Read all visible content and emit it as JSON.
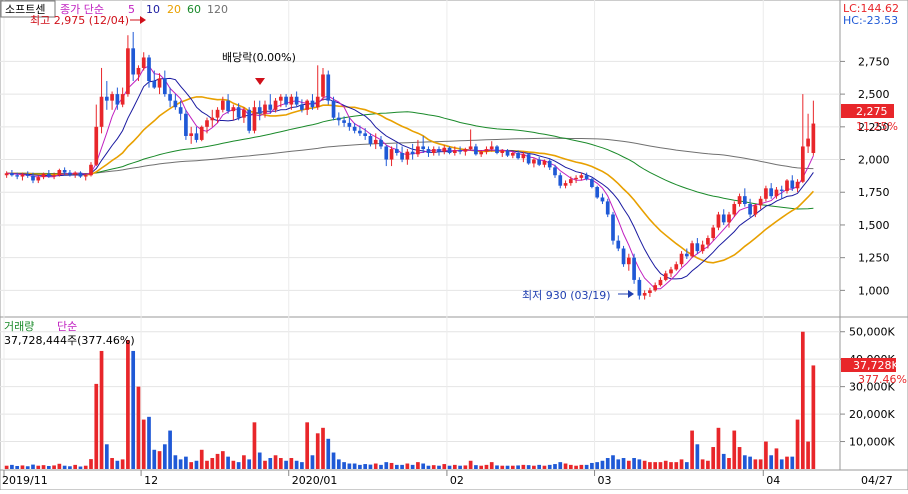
{
  "header": {
    "stock_name": "소프트센",
    "price_label": "종가 단순",
    "ma_labels": [
      {
        "text": "5",
        "color": "#c020c0"
      },
      {
        "text": "10",
        "color": "#1a1aa0"
      },
      {
        "text": "20",
        "color": "#e8a000"
      },
      {
        "text": "60",
        "color": "#1a8a2a"
      },
      {
        "text": "120",
        "color": "#707070"
      }
    ],
    "lc": "LC:144.62",
    "hc": "HC:-23.53"
  },
  "annotations": {
    "high": "최고 2,975 (12/04)",
    "dividend": "배당락(0.00%)",
    "low": "최저 930 (03/19)"
  },
  "price_badge": {
    "value": "2,275",
    "pct": "11.25%"
  },
  "volume_header": {
    "label": "거래량",
    "label2": "단순",
    "value": "37,728,444주(377.46%)"
  },
  "volume_badge": {
    "value": "37,728K",
    "pct": "377.46%"
  },
  "price_axis": [
    "2,750",
    "2,500",
    "2,250",
    "2,000",
    "1,750",
    "1,500",
    "1,250",
    "1,000"
  ],
  "volume_axis": [
    "50,000K",
    "40,000K",
    "30,000K",
    "20,000K",
    "10,000K"
  ],
  "date_axis": [
    "2019/11",
    "12",
    "2020/01",
    "02",
    "03",
    "04",
    "04/27"
  ],
  "colors": {
    "up": "#e8262a",
    "down": "#1f59d6",
    "ma5": "#c020c0",
    "ma10": "#1a1aa0",
    "ma20": "#e8a000",
    "ma60": "#1a8a2a",
    "ma120": "#707070"
  },
  "chart_data": {
    "type": "candlestick",
    "price_range": [
      850,
      2990
    ],
    "volume_range_k": [
      0,
      55000
    ],
    "candles": [
      [
        1880,
        1910,
        1860,
        1895,
        1200
      ],
      [
        1895,
        1920,
        1870,
        1880,
        1500
      ],
      [
        1880,
        1900,
        1850,
        1870,
        1100
      ],
      [
        1870,
        1900,
        1840,
        1885,
        1300
      ],
      [
        1885,
        1910,
        1860,
        1875,
        1000
      ],
      [
        1875,
        1900,
        1820,
        1840,
        1600
      ],
      [
        1840,
        1880,
        1820,
        1865,
        1200
      ],
      [
        1865,
        1900,
        1850,
        1890,
        1400
      ],
      [
        1890,
        1920,
        1860,
        1870,
        1100
      ],
      [
        1870,
        1900,
        1850,
        1880,
        1300
      ],
      [
        1880,
        1930,
        1870,
        1920,
        1900
      ],
      [
        1920,
        1940,
        1880,
        1900,
        1200
      ],
      [
        1900,
        1920,
        1870,
        1885,
        1000
      ],
      [
        1885,
        1910,
        1860,
        1900,
        1500
      ],
      [
        1900,
        1910,
        1860,
        1870,
        900
      ],
      [
        1870,
        1890,
        1840,
        1880,
        1200
      ],
      [
        1880,
        1980,
        1870,
        1960,
        3600
      ],
      [
        1960,
        2420,
        1950,
        2250,
        31000
      ],
      [
        2250,
        2700,
        2200,
        2480,
        43000
      ],
      [
        2480,
        2600,
        2380,
        2450,
        9000
      ],
      [
        2450,
        2520,
        2380,
        2500,
        4000
      ],
      [
        2500,
        2550,
        2380,
        2420,
        3000
      ],
      [
        2420,
        2550,
        2400,
        2500,
        3500
      ],
      [
        2500,
        2950,
        2480,
        2850,
        47000
      ],
      [
        2850,
        2975,
        2600,
        2650,
        43000
      ],
      [
        2650,
        2720,
        2600,
        2700,
        30000
      ],
      [
        2700,
        2820,
        2680,
        2780,
        18000
      ],
      [
        2780,
        2800,
        2550,
        2600,
        19000
      ],
      [
        2600,
        2680,
        2540,
        2550,
        7000
      ],
      [
        2550,
        2660,
        2500,
        2620,
        6500
      ],
      [
        2620,
        2680,
        2480,
        2500,
        9000
      ],
      [
        2500,
        2550,
        2400,
        2450,
        14000
      ],
      [
        2450,
        2500,
        2380,
        2400,
        5000
      ],
      [
        2400,
        2450,
        2300,
        2350,
        3500
      ],
      [
        2350,
        2380,
        2150,
        2180,
        4500
      ],
      [
        2180,
        2250,
        2120,
        2200,
        2500
      ],
      [
        2200,
        2250,
        2130,
        2150,
        3000
      ],
      [
        2150,
        2260,
        2140,
        2250,
        7000
      ],
      [
        2250,
        2320,
        2200,
        2300,
        3000
      ],
      [
        2300,
        2380,
        2250,
        2320,
        4000
      ],
      [
        2320,
        2400,
        2280,
        2380,
        5500
      ],
      [
        2380,
        2480,
        2360,
        2450,
        6500
      ],
      [
        2450,
        2500,
        2350,
        2370,
        4500
      ],
      [
        2370,
        2420,
        2300,
        2400,
        3000
      ],
      [
        2400,
        2430,
        2300,
        2320,
        2500
      ],
      [
        2320,
        2400,
        2280,
        2380,
        5000
      ],
      [
        2380,
        2400,
        2200,
        2220,
        3500
      ],
      [
        2220,
        2450,
        2200,
        2400,
        17000
      ],
      [
        2400,
        2450,
        2300,
        2350,
        6000
      ],
      [
        2350,
        2450,
        2320,
        2420,
        3000
      ],
      [
        2420,
        2500,
        2350,
        2380,
        4000
      ],
      [
        2380,
        2470,
        2360,
        2450,
        5000
      ],
      [
        2450,
        2500,
        2400,
        2480,
        4000
      ],
      [
        2480,
        2500,
        2400,
        2420,
        3000
      ],
      [
        2420,
        2500,
        2380,
        2480,
        4000
      ],
      [
        2480,
        2520,
        2400,
        2420,
        3000
      ],
      [
        2420,
        2460,
        2360,
        2380,
        2500
      ],
      [
        2380,
        2460,
        2340,
        2450,
        17000
      ],
      [
        2450,
        2500,
        2380,
        2400,
        5000
      ],
      [
        2400,
        2720,
        2380,
        2480,
        13000
      ],
      [
        2480,
        2700,
        2450,
        2650,
        15000
      ],
      [
        2650,
        2680,
        2420,
        2450,
        11000
      ],
      [
        2450,
        2480,
        2300,
        2320,
        6000
      ],
      [
        2320,
        2360,
        2260,
        2300,
        3500
      ],
      [
        2300,
        2330,
        2250,
        2280,
        2500
      ],
      [
        2280,
        2320,
        2220,
        2250,
        2000
      ],
      [
        2250,
        2280,
        2200,
        2220,
        2000
      ],
      [
        2220,
        2260,
        2180,
        2200,
        1500
      ],
      [
        2200,
        2240,
        2150,
        2180,
        1800
      ],
      [
        2180,
        2200,
        2100,
        2120,
        1600
      ],
      [
        2120,
        2200,
        2080,
        2150,
        2000
      ],
      [
        2150,
        2180,
        2080,
        2100,
        1500
      ],
      [
        2100,
        2110,
        1950,
        2000,
        2500
      ],
      [
        2000,
        2100,
        1950,
        2080,
        2200
      ],
      [
        2080,
        2120,
        2030,
        2050,
        1500
      ],
      [
        2050,
        2100,
        1980,
        2000,
        1500
      ],
      [
        2000,
        2080,
        1960,
        2060,
        2000
      ],
      [
        2060,
        2120,
        2000,
        2040,
        1500
      ],
      [
        2040,
        2150,
        2020,
        2100,
        2500
      ],
      [
        2100,
        2180,
        2050,
        2080,
        2000
      ],
      [
        2080,
        2100,
        2020,
        2050,
        1200
      ],
      [
        2050,
        2100,
        2030,
        2080,
        1400
      ],
      [
        2080,
        2100,
        2030,
        2060,
        1200
      ],
      [
        2060,
        2110,
        2040,
        2090,
        1800
      ],
      [
        2090,
        2100,
        2040,
        2050,
        1200
      ],
      [
        2050,
        2100,
        2030,
        2070,
        1500
      ],
      [
        2070,
        2100,
        2040,
        2060,
        1200
      ],
      [
        2060,
        2090,
        2030,
        2080,
        1300
      ],
      [
        2080,
        2230,
        2070,
        2100,
        3000
      ],
      [
        2100,
        2120,
        2030,
        2040,
        1400
      ],
      [
        2040,
        2070,
        2020,
        2060,
        1200
      ],
      [
        2060,
        2100,
        2040,
        2080,
        1500
      ],
      [
        2080,
        2140,
        2060,
        2100,
        2500
      ],
      [
        2100,
        2110,
        2040,
        2050,
        1300
      ],
      [
        2050,
        2080,
        2020,
        2070,
        1200
      ],
      [
        2070,
        2080,
        2020,
        2030,
        1200
      ],
      [
        2030,
        2060,
        2010,
        2050,
        1200
      ],
      [
        2050,
        2070,
        2000,
        2010,
        1300
      ],
      [
        2010,
        2060,
        1980,
        2040,
        1500
      ],
      [
        2040,
        2050,
        1960,
        1970,
        1400
      ],
      [
        1970,
        2010,
        1940,
        2000,
        1200
      ],
      [
        2000,
        2020,
        1950,
        1960,
        1500
      ],
      [
        1960,
        2000,
        1940,
        1990,
        1200
      ],
      [
        1990,
        2010,
        1920,
        1940,
        1500
      ],
      [
        1940,
        1960,
        1860,
        1880,
        1800
      ],
      [
        1880,
        1900,
        1780,
        1800,
        2500
      ],
      [
        1800,
        1840,
        1780,
        1820,
        2000
      ],
      [
        1820,
        1870,
        1800,
        1850,
        1500
      ],
      [
        1850,
        1880,
        1820,
        1860,
        1200
      ],
      [
        1860,
        1900,
        1840,
        1880,
        1500
      ],
      [
        1880,
        1900,
        1840,
        1850,
        1500
      ],
      [
        1850,
        1860,
        1780,
        1790,
        2200
      ],
      [
        1790,
        1800,
        1700,
        1710,
        2500
      ],
      [
        1710,
        1740,
        1660,
        1680,
        3000
      ],
      [
        1680,
        1700,
        1560,
        1580,
        4000
      ],
      [
        1580,
        1600,
        1350,
        1380,
        5000
      ],
      [
        1380,
        1420,
        1300,
        1320,
        3500
      ],
      [
        1320,
        1340,
        1180,
        1200,
        4000
      ],
      [
        1200,
        1280,
        1150,
        1250,
        3000
      ],
      [
        1250,
        1280,
        1050,
        1080,
        4000
      ],
      [
        1080,
        1100,
        930,
        960,
        3500
      ],
      [
        960,
        1000,
        930,
        980,
        3000
      ],
      [
        980,
        1020,
        950,
        1000,
        2500
      ],
      [
        1000,
        1060,
        990,
        1040,
        2500
      ],
      [
        1040,
        1100,
        1030,
        1080,
        2500
      ],
      [
        1080,
        1150,
        1070,
        1130,
        3000
      ],
      [
        1130,
        1180,
        1100,
        1160,
        2500
      ],
      [
        1160,
        1220,
        1150,
        1200,
        2500
      ],
      [
        1200,
        1300,
        1180,
        1280,
        3500
      ],
      [
        1280,
        1320,
        1240,
        1260,
        2500
      ],
      [
        1260,
        1380,
        1250,
        1360,
        14000
      ],
      [
        1360,
        1400,
        1280,
        1300,
        9000
      ],
      [
        1300,
        1380,
        1280,
        1350,
        3500
      ],
      [
        1350,
        1420,
        1320,
        1400,
        3000
      ],
      [
        1400,
        1500,
        1380,
        1480,
        8000
      ],
      [
        1480,
        1600,
        1460,
        1580,
        15000
      ],
      [
        1580,
        1620,
        1500,
        1520,
        5500
      ],
      [
        1520,
        1600,
        1480,
        1580,
        4000
      ],
      [
        1580,
        1680,
        1560,
        1660,
        14000
      ],
      [
        1660,
        1740,
        1640,
        1720,
        8000
      ],
      [
        1720,
        1780,
        1640,
        1660,
        5000
      ],
      [
        1660,
        1700,
        1560,
        1580,
        4500
      ],
      [
        1580,
        1660,
        1560,
        1650,
        3500
      ],
      [
        1650,
        1720,
        1620,
        1700,
        3500
      ],
      [
        1700,
        1800,
        1680,
        1780,
        10000
      ],
      [
        1780,
        1820,
        1700,
        1720,
        5000
      ],
      [
        1720,
        1790,
        1700,
        1770,
        7500
      ],
      [
        1770,
        1800,
        1700,
        1760,
        3500
      ],
      [
        1760,
        1850,
        1740,
        1840,
        4500
      ],
      [
        1840,
        1880,
        1760,
        1780,
        4500
      ],
      [
        1780,
        1850,
        1750,
        1830,
        18000
      ],
      [
        1830,
        2500,
        1820,
        2100,
        50000
      ],
      [
        2100,
        2350,
        2050,
        2160,
        10000
      ],
      [
        2050,
        2450,
        2030,
        2275,
        37728
      ]
    ]
  }
}
